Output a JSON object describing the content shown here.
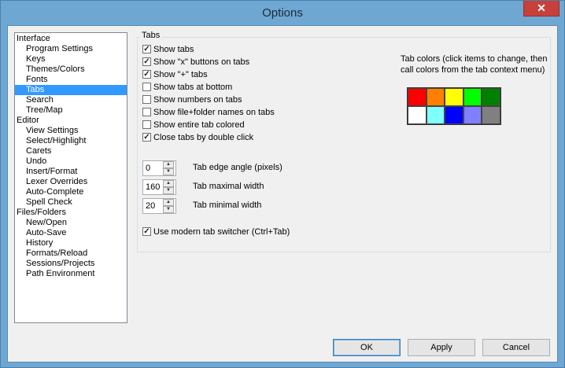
{
  "window": {
    "title": "Options",
    "close_glyph": "✕"
  },
  "tree": {
    "items": [
      {
        "label": "Interface",
        "level": 0
      },
      {
        "label": "Program Settings",
        "level": 1
      },
      {
        "label": "Keys",
        "level": 1
      },
      {
        "label": "Themes/Colors",
        "level": 1
      },
      {
        "label": "Fonts",
        "level": 1
      },
      {
        "label": "Tabs",
        "level": 1,
        "selected": true
      },
      {
        "label": "Search",
        "level": 1
      },
      {
        "label": "Tree/Map",
        "level": 1
      },
      {
        "label": "Editor",
        "level": 0
      },
      {
        "label": "View Settings",
        "level": 1
      },
      {
        "label": "Select/Highlight",
        "level": 1
      },
      {
        "label": "Carets",
        "level": 1
      },
      {
        "label": "Undo",
        "level": 1
      },
      {
        "label": "Insert/Format",
        "level": 1
      },
      {
        "label": "Lexer Overrides",
        "level": 1
      },
      {
        "label": "Auto-Complete",
        "level": 1
      },
      {
        "label": "Spell Check",
        "level": 1
      },
      {
        "label": "Files/Folders",
        "level": 0
      },
      {
        "label": "New/Open",
        "level": 1
      },
      {
        "label": "Auto-Save",
        "level": 1
      },
      {
        "label": "History",
        "level": 1
      },
      {
        "label": "Formats/Reload",
        "level": 1
      },
      {
        "label": "Sessions/Projects",
        "level": 1
      },
      {
        "label": "Path Environment",
        "level": 1
      }
    ]
  },
  "tabs": {
    "group_label": "Tabs",
    "checkboxes": [
      {
        "label": "Show tabs",
        "checked": true
      },
      {
        "label": "Show \"x\" buttons on tabs",
        "checked": true
      },
      {
        "label": "Show \"+\" tabs",
        "checked": true
      },
      {
        "label": "Show tabs at bottom",
        "checked": false
      },
      {
        "label": "Show numbers on tabs",
        "checked": false
      },
      {
        "label": "Show file+folder names on tabs",
        "checked": false
      },
      {
        "label": "Show entire tab colored",
        "checked": false
      },
      {
        "label": "Close tabs by double click",
        "checked": true
      }
    ],
    "spinners": [
      {
        "value": "0",
        "label": "Tab edge angle (pixels)"
      },
      {
        "value": "160",
        "label": "Tab maximal width"
      },
      {
        "value": "20",
        "label": "Tab minimal width"
      }
    ],
    "modern_switcher": {
      "label": "Use modern tab switcher (Ctrl+Tab)",
      "checked": true
    },
    "colors_caption": "Tab colors (click items to change, then call colors from the tab context menu)",
    "colors": [
      "#ff0000",
      "#ff8000",
      "#ffff00",
      "#00ff00",
      "#008000",
      "#ffffff",
      "#80ffff",
      "#0000ff",
      "#8080ff",
      "#808080"
    ]
  },
  "buttons": {
    "ok": "OK",
    "apply": "Apply",
    "cancel": "Cancel"
  }
}
